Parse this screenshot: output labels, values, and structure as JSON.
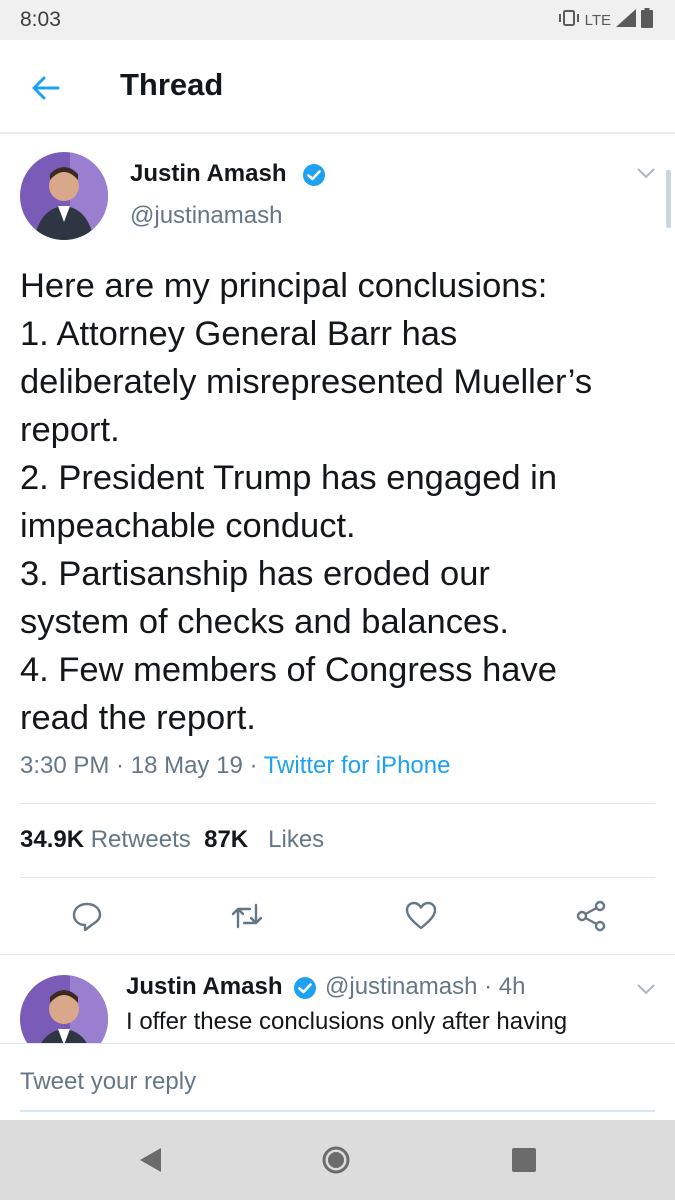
{
  "status_bar": {
    "time": "8:03",
    "network": "LTE"
  },
  "header": {
    "title": "Thread",
    "back_icon": "arrow-left-icon"
  },
  "tweet": {
    "author_name": "Justin Amash",
    "author_handle": "@justinamash",
    "verified": true,
    "text_lines": [
      "Here are my principal conclusions:",
      "1. Attorney General Barr has",
      "deliberately misrepresented Mueller’s",
      "report.",
      "2. President Trump has engaged in",
      "impeachable conduct.",
      "3. Partisanship has eroded our",
      "system of checks and balances.",
      "4. Few members of Congress have",
      "read the report."
    ],
    "time": "3:30 PM",
    "date": "18 May 19",
    "source": "Twitter for iPhone",
    "separator": " · ",
    "retweets_count": "34.9K",
    "retweets_label": "Retweets",
    "likes_count": "87K",
    "likes_label": "Likes"
  },
  "reply_tweet": {
    "author_name": "Justin Amash",
    "author_handle": "@justinamash",
    "age": "· 4h",
    "text": "I offer these conclusions only after having"
  },
  "reply_input": {
    "placeholder": "Tweet your reply"
  },
  "colors": {
    "accent": "#1da1f2",
    "secondary_text": "#657786",
    "primary_text": "#14171a"
  }
}
